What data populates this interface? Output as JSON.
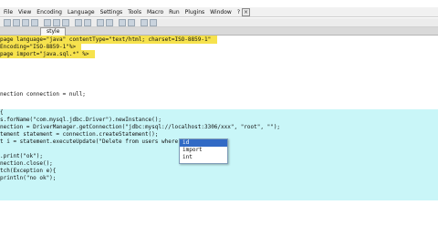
{
  "menubar": {
    "items": [
      "File",
      "View",
      "Encoding",
      "Language",
      "Settings",
      "Tools",
      "Macro",
      "Run",
      "Plugins",
      "Window",
      "?"
    ]
  },
  "window_controls": {
    "close": "×"
  },
  "tab": {
    "label": "style"
  },
  "editor": {
    "lines": [
      {
        "text": "page language=\"java\" contentType=\"text/html; charset=ISO-8859-1\"",
        "style": "yellow"
      },
      {
        "text": "Encoding=\"ISO-8859-1\"%>",
        "style": "yellow"
      },
      {
        "text": "page import=\"java.sql.*\" %>",
        "style": "yellow"
      },
      {
        "text": "",
        "style": "plain"
      },
      {
        "text": "",
        "style": "plain"
      },
      {
        "text": "nection connection = null;",
        "style": "cyan"
      },
      {
        "text": "",
        "style": "cyan"
      },
      {
        "text": "{",
        "style": "cyan"
      },
      {
        "text": "s.forName(\"com.mysql.jdbc.Driver\").newInstance();",
        "style": "cyan"
      },
      {
        "text": "nection = DriverManager.getConnection(\"jdbc:mysql://localhost:3306/xxx\", \"root\", \"\");",
        "style": "cyan"
      },
      {
        "text": "tement statement = connection.createStatement();",
        "style": "cyan"
      },
      {
        "text": "t i = statement.executeUpdate(\"Delete from users where id=\"+id",
        "style": "cyan"
      },
      {
        "text": "",
        "style": "cyan"
      },
      {
        "text": ".print(\"ok\");",
        "style": "cyan"
      },
      {
        "text": "nection.close();",
        "style": "cyan"
      },
      {
        "text": "tch(Exception e){",
        "style": "cyan"
      },
      {
        "text": "println(\"no ok\");",
        "style": "cyan"
      }
    ]
  },
  "autocomplete": {
    "items": [
      "id",
      "import",
      "int"
    ],
    "selected_index": 0
  }
}
